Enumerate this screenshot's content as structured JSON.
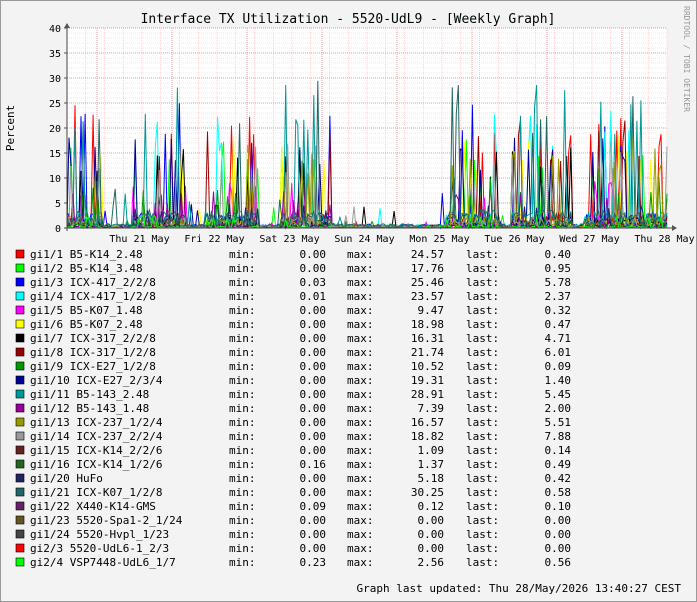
{
  "chart_data": {
    "type": "line",
    "title": "Interface TX Utilization - 5520-UdL9 - [Weekly Graph]",
    "ylabel": "Percent",
    "ylim": [
      0,
      40
    ],
    "yticks": [
      0,
      5,
      10,
      15,
      20,
      25,
      30,
      35,
      40
    ],
    "x_ticks": [
      "Thu 21 May",
      "Fri 22 May",
      "Sat 23 May",
      "Sun 24 May",
      "Mon 25 May",
      "Tue 26 May",
      "Wed 27 May",
      "Thu 28 May"
    ],
    "grid": true,
    "watermark": "RRDTOOL / TOBI OETIKER",
    "stat_labels": {
      "min": "min:",
      "max": "max:",
      "last": "last:"
    },
    "series": [
      {
        "name": "gi1/1 B5-K14_2.48",
        "color": "#ff0000",
        "min": "0.00",
        "max": "24.57",
        "last": "0.40"
      },
      {
        "name": "gi1/2 B5-K14_3.48",
        "color": "#00ff00",
        "min": "0.00",
        "max": "17.76",
        "last": "0.95"
      },
      {
        "name": "gi1/3 ICX-417_2/2/8",
        "color": "#0000ff",
        "min": "0.03",
        "max": "25.46",
        "last": "5.78"
      },
      {
        "name": "gi1/4 ICX-417_1/2/8",
        "color": "#00ffff",
        "min": "0.01",
        "max": "23.57",
        "last": "2.37"
      },
      {
        "name": "gi1/5 B5-K07_1.48",
        "color": "#ff00ff",
        "min": "0.00",
        "max": "9.47",
        "last": "0.32"
      },
      {
        "name": "gi1/6 B5-K07_2.48",
        "color": "#ffff00",
        "min": "0.00",
        "max": "18.98",
        "last": "0.47"
      },
      {
        "name": "gi1/7 ICX-317_2/2/8",
        "color": "#000000",
        "min": "0.00",
        "max": "16.31",
        "last": "4.71"
      },
      {
        "name": "gi1/8 ICX-317_1/2/8",
        "color": "#990000",
        "min": "0.00",
        "max": "21.74",
        "last": "6.01"
      },
      {
        "name": "gi1/9 ICX-E27_1/2/8",
        "color": "#009900",
        "min": "0.00",
        "max": "10.52",
        "last": "0.09"
      },
      {
        "name": "gi1/10 ICX-E27_2/3/4",
        "color": "#000099",
        "min": "0.00",
        "max": "19.31",
        "last": "1.40"
      },
      {
        "name": "gi1/11 B5-143_2.48",
        "color": "#009999",
        "min": "0.00",
        "max": "28.91",
        "last": "5.45"
      },
      {
        "name": "gi1/12 B5-143_1.48",
        "color": "#990099",
        "min": "0.00",
        "max": "7.39",
        "last": "2.00"
      },
      {
        "name": "gi1/13 ICX-237_1/2/4",
        "color": "#999900",
        "min": "0.00",
        "max": "16.57",
        "last": "5.51"
      },
      {
        "name": "gi1/14 ICX-237_2/2/4",
        "color": "#999999",
        "min": "0.00",
        "max": "18.82",
        "last": "7.88"
      },
      {
        "name": "gi1/15 ICX-K14_2/2/6",
        "color": "#662222",
        "min": "0.00",
        "max": "1.09",
        "last": "0.14"
      },
      {
        "name": "gi1/16 ICX-K14_1/2/6",
        "color": "#226622",
        "min": "0.16",
        "max": "1.37",
        "last": "0.49"
      },
      {
        "name": "gi1/20 HuFo",
        "color": "#222266",
        "min": "0.00",
        "max": "5.18",
        "last": "0.42"
      },
      {
        "name": "gi1/21 ICX-K07_1/2/8",
        "color": "#226666",
        "min": "0.00",
        "max": "30.25",
        "last": "0.58"
      },
      {
        "name": "gi1/22 X440-K14-GMS",
        "color": "#662266",
        "min": "0.09",
        "max": "0.12",
        "last": "0.10"
      },
      {
        "name": "gi1/23 5520-Spa1-2_1/24",
        "color": "#665522",
        "min": "0.00",
        "max": "0.00",
        "last": "0.00"
      },
      {
        "name": "gi1/24 5520-Hvpl_1/23",
        "color": "#444444",
        "min": "0.00",
        "max": "0.00",
        "last": "0.00"
      },
      {
        "name": "gi2/3 5520-UdL6-1_2/3",
        "color": "#ff0000",
        "min": "0.00",
        "max": "0.00",
        "last": "0.00"
      },
      {
        "name": "gi2/4 VSP7448-UdL6_1/7",
        "color": "#00ff00",
        "min": "0.23",
        "max": "2.56",
        "last": "0.56"
      }
    ],
    "footer": "Graph last updated: Thu 28/May/2026 13:40:27 CEST"
  }
}
